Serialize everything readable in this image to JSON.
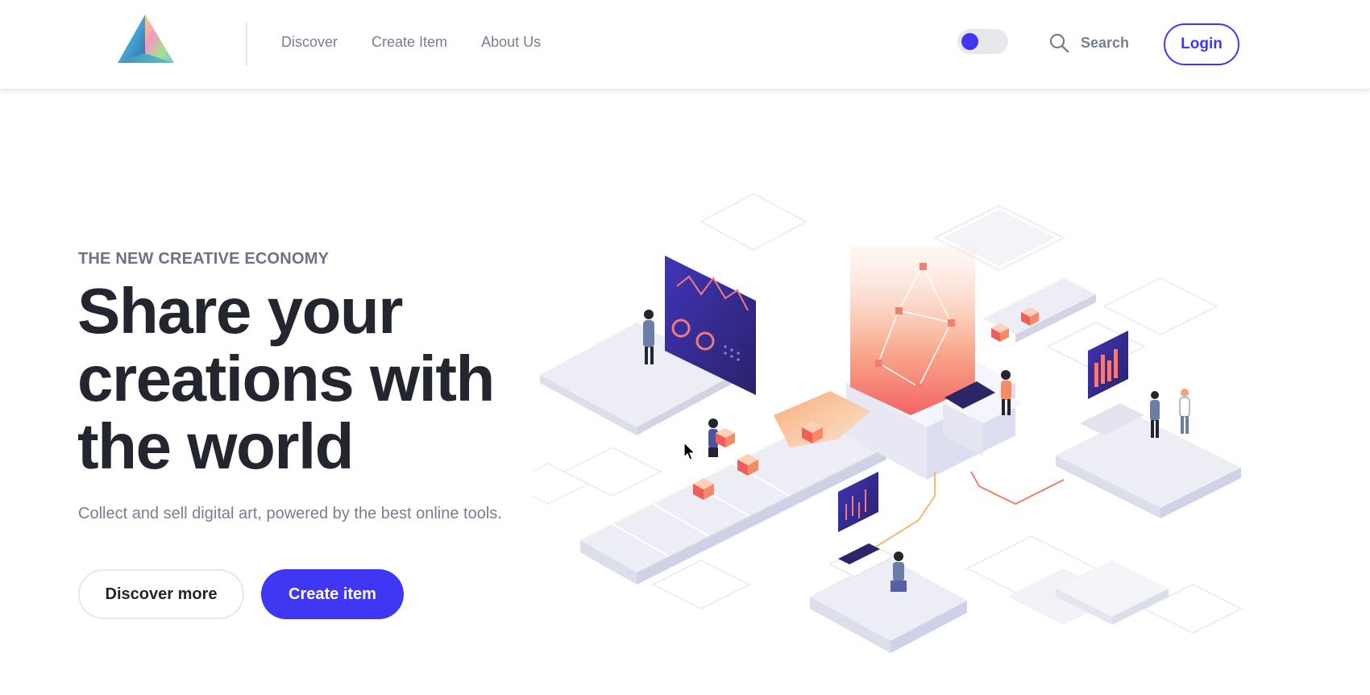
{
  "header": {
    "logo_icon": "prism-triangle-logo",
    "nav": [
      {
        "label": "Discover"
      },
      {
        "label": "Create Item"
      },
      {
        "label": "About Us"
      }
    ],
    "theme_toggle": {
      "icon": "toggle-switch",
      "state": "off"
    },
    "search": {
      "icon": "search-icon",
      "label": "Search"
    },
    "login_label": "Login"
  },
  "hero": {
    "kicker": "THE NEW CREATIVE ECONOMY",
    "headline": "Share your creations with the world",
    "subtitle": "Collect and sell digital art, powered by the best online tools.",
    "primary_cta": "Create item",
    "secondary_cta": "Discover more",
    "illustration": "isometric-creative-economy-illustration"
  },
  "colors": {
    "accent": "#3F37F4",
    "text_dark": "#23262F",
    "text_muted": "#777E90",
    "border": "#E6E8EC"
  }
}
